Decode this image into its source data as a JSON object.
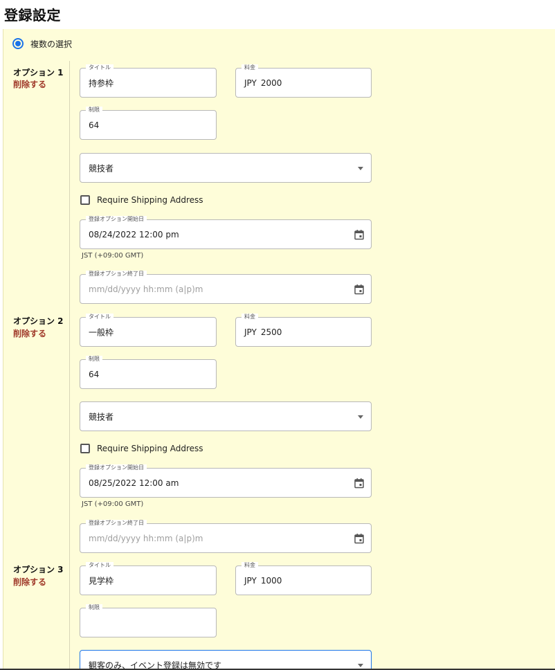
{
  "page": {
    "title": "登録設定"
  },
  "multi_select": {
    "label": "複数の選択",
    "checked": true
  },
  "labels": {
    "title": "タイトル",
    "price": "料金",
    "limit": "制限",
    "start_date": "登録オプション開始日",
    "end_date": "登録オプション終了日",
    "require_shipping": "Require Shipping Address",
    "delete": "削除する",
    "currency": "JPY",
    "date_placeholder": "mm/dd/yyyy hh:mm (a|p)m",
    "timezone": "JST (+09:00 GMT)"
  },
  "options": [
    {
      "label": "オプション 1",
      "title": "持参枠",
      "price": "2000",
      "limit": "64",
      "type": "競技者",
      "require_shipping": false,
      "start_date": "08/24/2022 12:00 pm",
      "end_date": ""
    },
    {
      "label": "オプション 2",
      "title": "一般枠",
      "price": "2500",
      "limit": "64",
      "type": "競技者",
      "require_shipping": false,
      "start_date": "08/25/2022 12:00 am",
      "end_date": ""
    },
    {
      "label": "オプション 3",
      "title": "見学枠",
      "price": "1000",
      "limit": "",
      "type": "観客のみ、イベント登録は無効です"
    }
  ],
  "icons": {
    "calendar": "calendar-icon",
    "dropdown": "chevron-down-icon"
  },
  "colors": {
    "panel_bg": "#fefdd9",
    "accent": "#1a73e8",
    "delete": "#a03a2a"
  }
}
